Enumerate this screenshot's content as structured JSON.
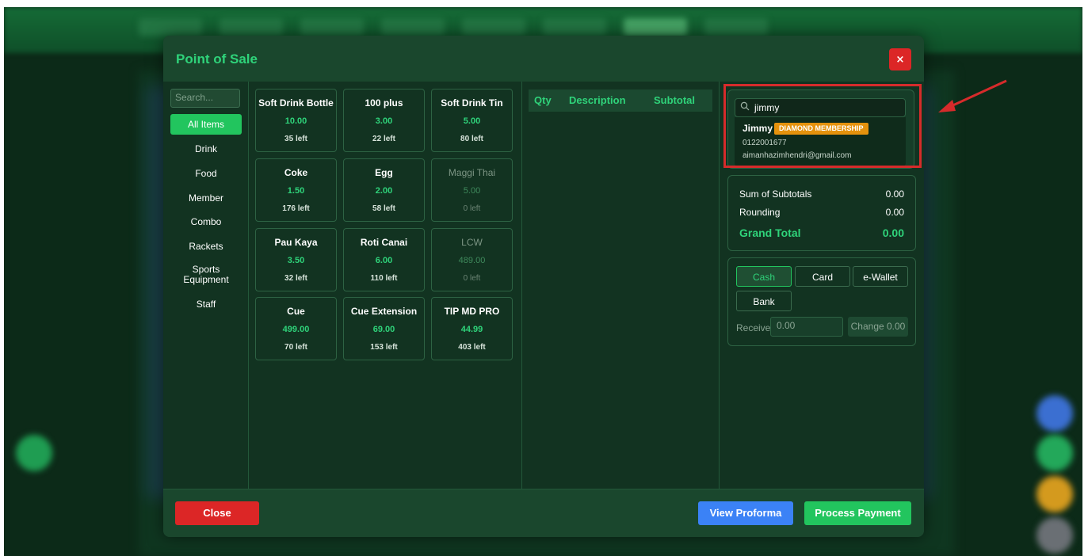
{
  "modal": {
    "title": "Point of Sale",
    "close_icon": "×"
  },
  "categories": {
    "search_placeholder": "Search...",
    "items": [
      "All Items",
      "Drink",
      "Food",
      "Member",
      "Combo",
      "Rackets",
      "Sports Equipment",
      "Staff"
    ],
    "active": "All Items"
  },
  "products": [
    {
      "name": "Soft Drink Bottle",
      "price": "10.00",
      "stock": "35 left",
      "available": true
    },
    {
      "name": "100 plus",
      "price": "3.00",
      "stock": "22 left",
      "available": true
    },
    {
      "name": "Soft Drink Tin",
      "price": "5.00",
      "stock": "80 left",
      "available": true
    },
    {
      "name": "Coke",
      "price": "1.50",
      "stock": "176 left",
      "available": true
    },
    {
      "name": "Egg",
      "price": "2.00",
      "stock": "58 left",
      "available": true
    },
    {
      "name": "Maggi Thai",
      "price": "5.00",
      "stock": "0 left",
      "available": false
    },
    {
      "name": "Pau Kaya",
      "price": "3.50",
      "stock": "32 left",
      "available": true
    },
    {
      "name": "Roti Canai",
      "price": "6.00",
      "stock": "110 left",
      "available": true
    },
    {
      "name": "LCW",
      "price": "489.00",
      "stock": "0 left",
      "available": false
    },
    {
      "name": "Cue",
      "price": "499.00",
      "stock": "70 left",
      "available": true
    },
    {
      "name": "Cue Extension",
      "price": "69.00",
      "stock": "153 left",
      "available": true
    },
    {
      "name": "TIP MD PRO",
      "price": "44.99",
      "stock": "403 left",
      "available": true
    }
  ],
  "order_table": {
    "headers": [
      "Qty",
      "Description",
      "Subtotal"
    ]
  },
  "customer": {
    "search_value": "jimmy",
    "result": {
      "name": "Jimmy",
      "badge": "DIAMOND MEMBERSHIP",
      "phone": "0122001677",
      "email": "aimanhazimhendri@gmail.com"
    }
  },
  "totals": {
    "sum_label": "Sum of Subtotals",
    "sum_value": "0.00",
    "rounding_label": "Rounding",
    "rounding_value": "0.00",
    "grand_label": "Grand Total",
    "grand_value": "0.00"
  },
  "payment": {
    "methods": [
      "Cash",
      "Card",
      "e-Wallet",
      "Bank"
    ],
    "active": "Cash",
    "receive_label": "Receive",
    "receive_placeholder": "0.00",
    "change_label": "Change 0.00"
  },
  "footer": {
    "close_label": "Close",
    "proforma_label": "View Proforma",
    "process_label": "Process Payment"
  },
  "colors": {
    "accent": "#22c55e",
    "danger": "#dc2626",
    "info": "#3b82f6",
    "badge": "#e5920d",
    "highlight": "#d62b2b"
  }
}
